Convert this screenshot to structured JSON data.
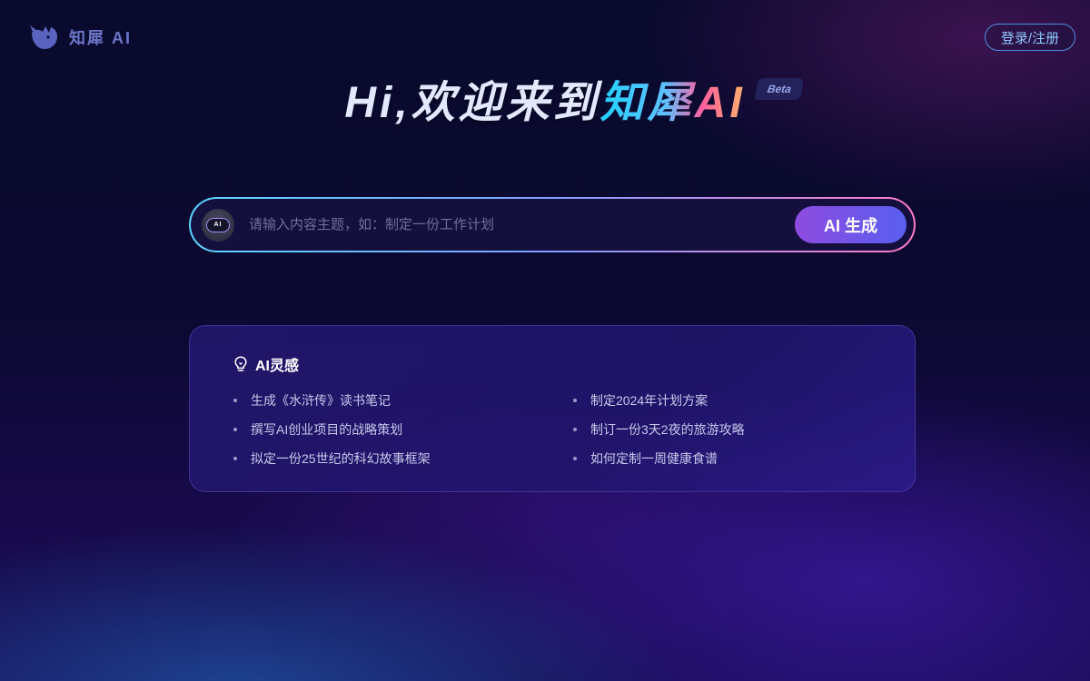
{
  "header": {
    "logo_text": "知犀 AI",
    "login_label": "登录/注册"
  },
  "hero": {
    "title": "Hi,欢迎来到",
    "brand": "知犀AI",
    "badge": "Beta"
  },
  "search": {
    "avatar_text": "AI",
    "placeholder": "请输入内容主题，如：制定一份工作计划",
    "value": "",
    "button_label": "AI 生成"
  },
  "inspiration": {
    "title": "AI灵感",
    "left": [
      {
        "text": "生成《水浒传》读书笔记"
      },
      {
        "text": "撰写AI创业项目的战略策划"
      },
      {
        "text": "拟定一份25世纪的科幻故事框架"
      }
    ],
    "right": [
      {
        "text": "制定2024年计划方案"
      },
      {
        "text": "制订一份3天2夜的旅游攻略"
      },
      {
        "text": "如何定制一周健康食谱"
      }
    ]
  },
  "icons": {
    "logo": "rhino-logo-icon",
    "bulb": "lightbulb-icon",
    "ai_avatar": "ai-robot-icon"
  },
  "colors": {
    "accent_start": "#8e4be0",
    "accent_end": "#5a5ff0",
    "login_border": "#4f8fe0"
  }
}
